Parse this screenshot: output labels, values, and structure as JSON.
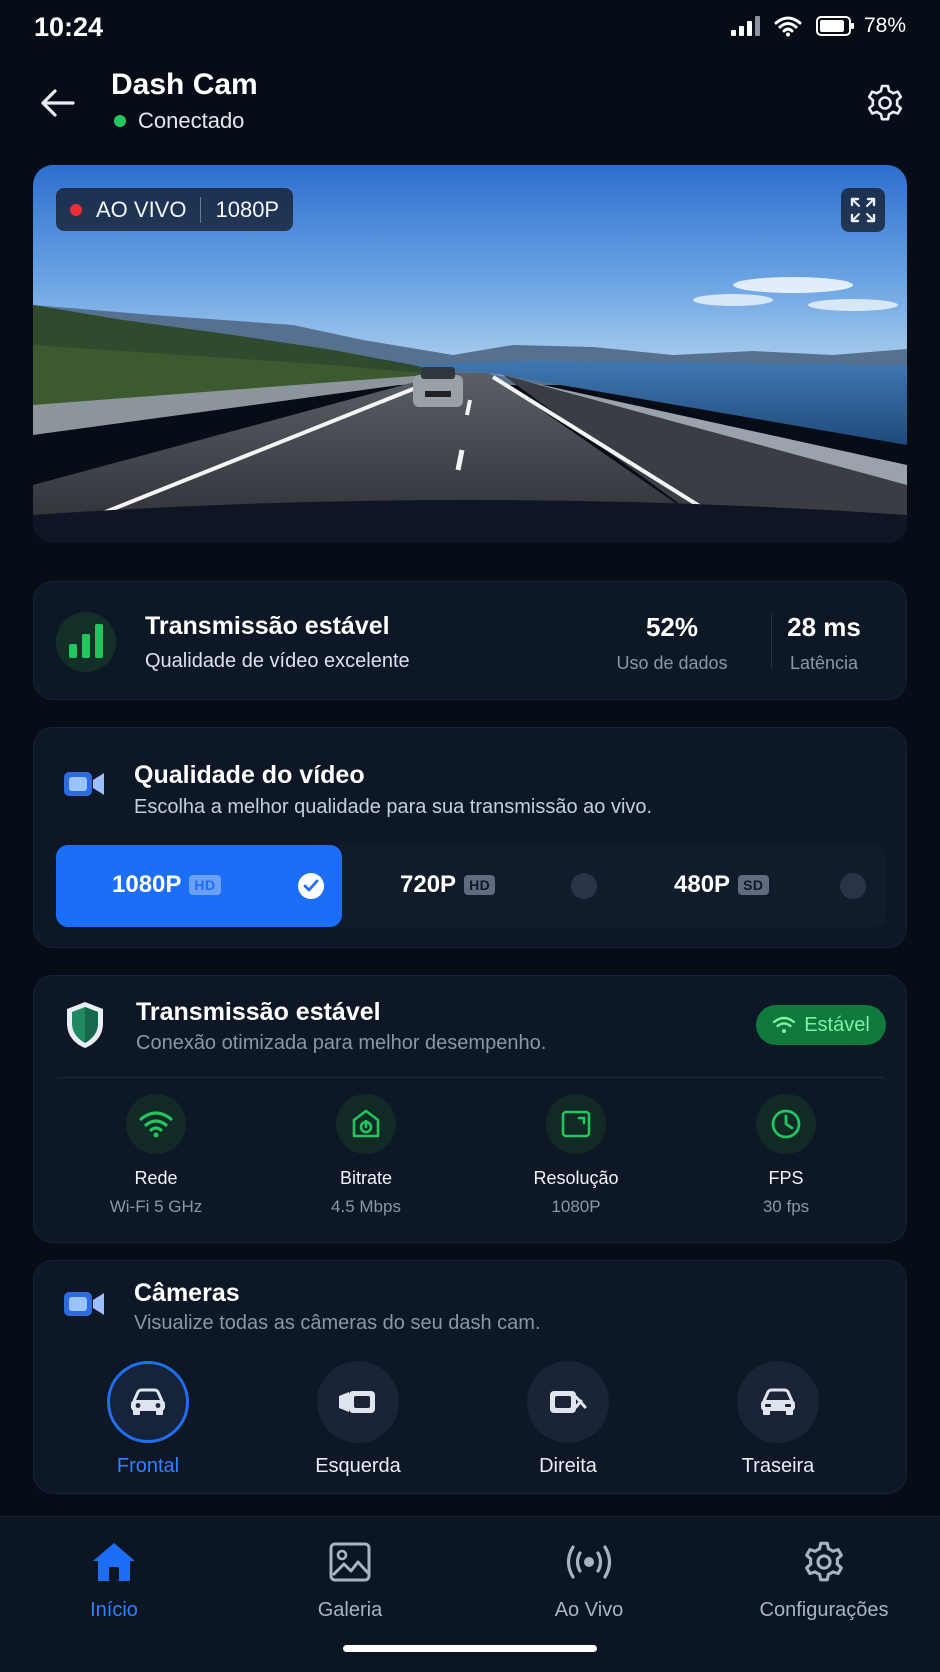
{
  "status_bar": {
    "time": "10:24",
    "battery": "78%"
  },
  "header": {
    "title": "Dash Cam",
    "status": "Conectado"
  },
  "video": {
    "live_label": "AO VIVO",
    "resolution": "1080P"
  },
  "stats": {
    "title": "Transmissão estável",
    "subtitle": "Qualidade de vídeo excelente",
    "metrics": [
      {
        "value": "52%",
        "label": "Uso de dados"
      },
      {
        "value": "28 ms",
        "label": "Latência"
      }
    ]
  },
  "quality": {
    "title": "Qualidade do vídeo",
    "subtitle": "Escolha a melhor qualidade para sua transmissão ao vivo.",
    "options": [
      {
        "label": "1080P",
        "tag": "HD",
        "selected": true
      },
      {
        "label": "720P",
        "tag": "HD",
        "selected": false
      },
      {
        "label": "480P",
        "tag": "SD",
        "selected": false
      }
    ]
  },
  "transmission": {
    "title": "Transmissão estável",
    "subtitle": "Conexão otimizada para melhor desempenho.",
    "badge": "Estável",
    "items": [
      {
        "label": "Rede",
        "value": "Wi-Fi 5 GHz",
        "icon": "wifi-icon"
      },
      {
        "label": "Bitrate",
        "value": "4.5 Mbps",
        "icon": "gauge-icon"
      },
      {
        "label": "Resolução",
        "value": "1080P",
        "icon": "screen-icon"
      },
      {
        "label": "FPS",
        "value": "30 fps",
        "icon": "clock-icon"
      }
    ]
  },
  "cameras": {
    "title": "Câmeras",
    "subtitle": "Visualize todas as câmeras do seu dash cam.",
    "items": [
      {
        "label": "Frontal",
        "active": true,
        "icon": "car-front-icon"
      },
      {
        "label": "Esquerda",
        "active": false,
        "icon": "camera-left-icon"
      },
      {
        "label": "Direita",
        "active": false,
        "icon": "camera-right-icon"
      },
      {
        "label": "Traseira",
        "active": false,
        "icon": "car-rear-icon"
      }
    ]
  },
  "nav": [
    {
      "label": "Início",
      "active": true,
      "icon": "home-icon"
    },
    {
      "label": "Galeria",
      "active": false,
      "icon": "gallery-icon"
    },
    {
      "label": "Ao Vivo",
      "active": false,
      "icon": "broadcast-icon"
    },
    {
      "label": "Configurações",
      "active": false,
      "icon": "settings-icon"
    }
  ],
  "colors": {
    "accent": "#1b6ef5",
    "success": "#22c55e",
    "background": "#070d17",
    "card": "#0e1726",
    "live": "#ef2b35"
  }
}
